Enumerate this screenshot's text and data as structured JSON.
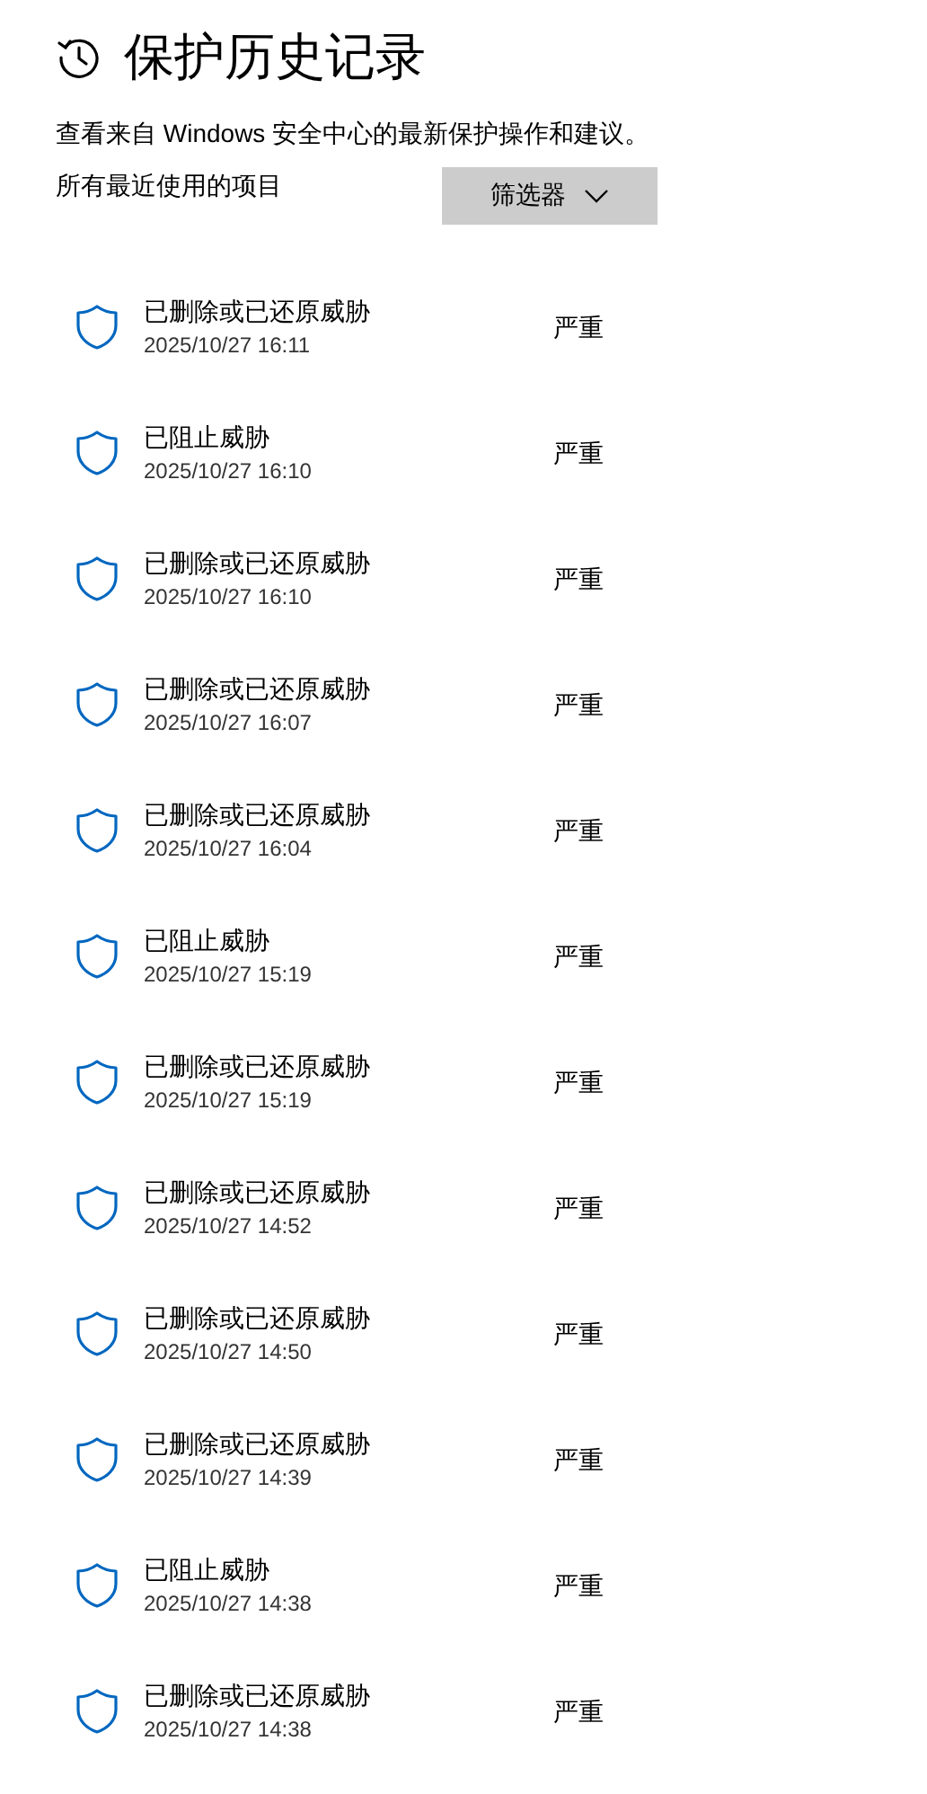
{
  "title": "保护历史记录",
  "subtitle": "查看来自 Windows 安全中心的最新保护操作和建议。",
  "section_label": "所有最近使用的项目",
  "filter_button": "筛选器",
  "items": [
    {
      "title": "已删除或已还原威胁",
      "time": "2025/10/27 16:11",
      "severity": "严重"
    },
    {
      "title": "已阻止威胁",
      "time": "2025/10/27 16:10",
      "severity": "严重"
    },
    {
      "title": "已删除或已还原威胁",
      "time": "2025/10/27 16:10",
      "severity": "严重"
    },
    {
      "title": "已删除或已还原威胁",
      "time": "2025/10/27 16:07",
      "severity": "严重"
    },
    {
      "title": "已删除或已还原威胁",
      "time": "2025/10/27 16:04",
      "severity": "严重"
    },
    {
      "title": "已阻止威胁",
      "time": "2025/10/27 15:19",
      "severity": "严重"
    },
    {
      "title": "已删除或已还原威胁",
      "time": "2025/10/27 15:19",
      "severity": "严重"
    },
    {
      "title": "已删除或已还原威胁",
      "time": "2025/10/27 14:52",
      "severity": "严重"
    },
    {
      "title": "已删除或已还原威胁",
      "time": "2025/10/27 14:50",
      "severity": "严重"
    },
    {
      "title": "已删除或已还原威胁",
      "time": "2025/10/27 14:39",
      "severity": "严重"
    },
    {
      "title": "已阻止威胁",
      "time": "2025/10/27 14:38",
      "severity": "严重"
    },
    {
      "title": "已删除或已还原威胁",
      "time": "2025/10/27 14:38",
      "severity": "严重"
    }
  ]
}
